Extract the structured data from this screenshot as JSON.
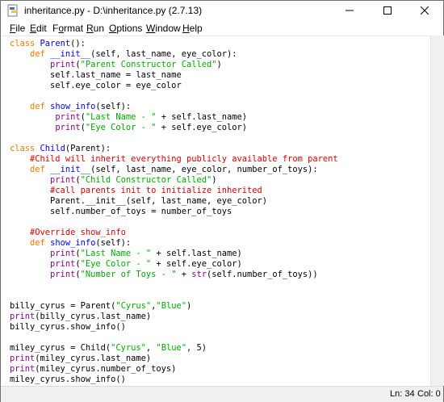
{
  "window": {
    "title": "inheritance.py - D:\\inheritance.py (2.7.13)"
  },
  "menu": [
    {
      "label": "File",
      "underline": "F",
      "rest": "ile"
    },
    {
      "label": "Edit",
      "underline": "E",
      "rest": "dit"
    },
    {
      "label": "Format",
      "underline": "",
      "pre": "F",
      "under_mid": "o",
      "rest": "rmat"
    },
    {
      "label": "Run",
      "underline": "R",
      "rest": "un"
    },
    {
      "label": "Options",
      "underline": "O",
      "rest": "ptions"
    },
    {
      "label": "Window",
      "underline": "W",
      "rest": "indow"
    },
    {
      "label": "Help",
      "underline": "H",
      "rest": "elp"
    }
  ],
  "code": {
    "lines": [
      "class Parent():",
      "    def __init__(self, last_name, eye_color):",
      "        print(\"Parent Constructor Called\")",
      "        self.last_name = last_name",
      "        self.eye_color = eye_color",
      "",
      "    def show_info(self):",
      "         print(\"Last Name - \" + self.last_name)",
      "         print(\"Eye Color - \" + self.eye_color)",
      "",
      "class Child(Parent):",
      "    #Child will inherit everything publicly available from parent",
      "    def __init__(self, last_name, eye_color, number_of_toys):",
      "        print(\"Child Constructor Called\")",
      "        #call parents init to initialize inherited",
      "        Parent.__init__(self, last_name, eye_color)",
      "        self.number_of_toys = number_of_toys",
      "",
      "    #Override show_info",
      "    def show_info(self):",
      "        print(\"Last Name - \" + self.last_name)",
      "        print(\"Eye Color - \" + self.eye_color)",
      "        print(\"Number of Toys - \" + str(self.number_of_toys))",
      "",
      "",
      "billy_cyrus = Parent(\"Cyrus\",\"Blue\")",
      "print(billy_cyrus.last_name)",
      "billy_cyrus.show_info()",
      "",
      "miley_cyrus = Child(\"Cyrus\", \"Blue\", 5)",
      "print(miley_cyrus.last_name)",
      "print(miley_cyrus.number_of_toys)",
      "miley_cyrus.show_info()"
    ]
  },
  "status": {
    "line": "Ln: 34",
    "col": "Col: 0"
  },
  "colors": {
    "keyword": "#ff7700",
    "builtin": "#900090",
    "string": "#00aa00",
    "comment": "#dd0000",
    "definition": "#0000ff"
  }
}
